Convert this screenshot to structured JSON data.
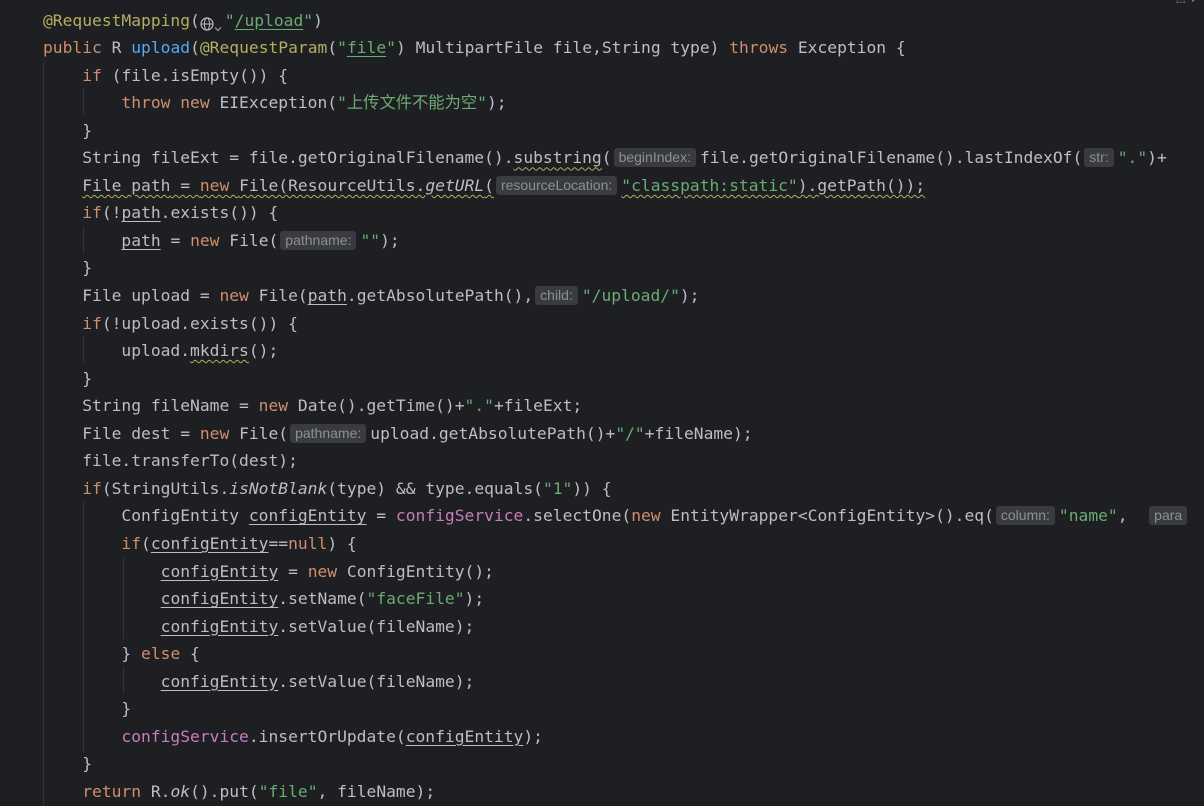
{
  "editor": {
    "lines": [
      {
        "tokens": [
          {
            "t": "@RequestMapping",
            "c": "ann"
          },
          {
            "t": "(",
            "c": "p"
          },
          {
            "icon": "globe-icon"
          },
          {
            "icon": "chevron-down-icon"
          },
          {
            "t": "\"",
            "c": "str"
          },
          {
            "t": "/upload",
            "c": "str ul"
          },
          {
            "t": "\"",
            "c": "str"
          },
          {
            "t": ")",
            "c": "p"
          }
        ]
      },
      {
        "tokens": [
          {
            "t": "public ",
            "c": "kw"
          },
          {
            "t": "R ",
            "c": "p"
          },
          {
            "t": "upload",
            "c": "fn"
          },
          {
            "t": "(",
            "c": "p"
          },
          {
            "t": "@RequestParam",
            "c": "ann"
          },
          {
            "t": "(",
            "c": "p"
          },
          {
            "t": "\"",
            "c": "str"
          },
          {
            "t": "file",
            "c": "str ul"
          },
          {
            "t": "\"",
            "c": "str"
          },
          {
            "t": ") MultipartFile file,String type) ",
            "c": "p"
          },
          {
            "t": "throws ",
            "c": "kw"
          },
          {
            "t": "Exception {",
            "c": "p"
          }
        ]
      },
      {
        "tokens": [
          {
            "t": "    "
          },
          {
            "t": "if ",
            "c": "kw"
          },
          {
            "t": "(file.isEmpty()) {",
            "c": "p"
          }
        ]
      },
      {
        "tokens": [
          {
            "t": "        "
          },
          {
            "t": "throw new ",
            "c": "kw"
          },
          {
            "t": "EIException(",
            "c": "p"
          },
          {
            "t": "\"上传文件不能为空\"",
            "c": "str"
          },
          {
            "t": ");",
            "c": "p"
          }
        ]
      },
      {
        "tokens": [
          {
            "t": "    "
          },
          {
            "t": "}",
            "c": "p"
          }
        ]
      },
      {
        "tokens": [
          {
            "t": "    "
          },
          {
            "t": "String fileExt = file.getOriginalFilename().",
            "c": "p"
          },
          {
            "t": "substring",
            "c": "p wavy"
          },
          {
            "t": "(",
            "c": "p"
          },
          {
            "hint": "beginIndex:"
          },
          {
            "t": "file.getOriginalFilename().lastIndexOf(",
            "c": "p"
          },
          {
            "hint": "str:"
          },
          {
            "t": "\".\"",
            "c": "str"
          },
          {
            "t": ")+",
            "c": "p"
          }
        ]
      },
      {
        "tokens": [
          {
            "t": "    "
          },
          {
            "t": "File ",
            "c": "p wavy"
          },
          {
            "t": "path",
            "c": "p wavy ul"
          },
          {
            "t": " = ",
            "c": "p wavy"
          },
          {
            "t": "new ",
            "c": "kw wavy"
          },
          {
            "t": "File(ResourceUtils.",
            "c": "p wavy"
          },
          {
            "t": "getURL",
            "c": "p ital wavy"
          },
          {
            "t": "(",
            "c": "p wavy"
          },
          {
            "hint": "resourceLocation:"
          },
          {
            "t": "\"classpath:static\"",
            "c": "str wavy"
          },
          {
            "t": ").getPath());",
            "c": "p wavy"
          }
        ]
      },
      {
        "tokens": [
          {
            "t": "    "
          },
          {
            "t": "if",
            "c": "kw"
          },
          {
            "t": "(!",
            "c": "p"
          },
          {
            "t": "path",
            "c": "p ul"
          },
          {
            "t": ".exists()) {",
            "c": "p"
          }
        ]
      },
      {
        "tokens": [
          {
            "t": "        "
          },
          {
            "t": "path",
            "c": "p ul"
          },
          {
            "t": " = ",
            "c": "p"
          },
          {
            "t": "new ",
            "c": "kw"
          },
          {
            "t": "File(",
            "c": "p"
          },
          {
            "hint": "pathname:"
          },
          {
            "t": "\"\"",
            "c": "str"
          },
          {
            "t": ");",
            "c": "p"
          }
        ]
      },
      {
        "tokens": [
          {
            "t": "    "
          },
          {
            "t": "}",
            "c": "p"
          }
        ]
      },
      {
        "tokens": [
          {
            "t": "    "
          },
          {
            "t": "File upload = ",
            "c": "p"
          },
          {
            "t": "new ",
            "c": "kw"
          },
          {
            "t": "File(",
            "c": "p"
          },
          {
            "t": "path",
            "c": "p ul"
          },
          {
            "t": ".getAbsolutePath(),",
            "c": "p"
          },
          {
            "hint": "child:"
          },
          {
            "t": "\"/upload/\"",
            "c": "str"
          },
          {
            "t": ");",
            "c": "p"
          }
        ]
      },
      {
        "tokens": [
          {
            "t": "    "
          },
          {
            "t": "if",
            "c": "kw"
          },
          {
            "t": "(!upload.exists()) {",
            "c": "p"
          }
        ]
      },
      {
        "tokens": [
          {
            "t": "        "
          },
          {
            "t": "upload.",
            "c": "p"
          },
          {
            "t": "mkdirs",
            "c": "p wavy"
          },
          {
            "t": "();",
            "c": "p"
          }
        ]
      },
      {
        "tokens": [
          {
            "t": "    "
          },
          {
            "t": "}",
            "c": "p"
          }
        ]
      },
      {
        "tokens": [
          {
            "t": "    "
          },
          {
            "t": "String fileName = ",
            "c": "p"
          },
          {
            "t": "new ",
            "c": "kw"
          },
          {
            "t": "Date().getTime()+",
            "c": "p"
          },
          {
            "t": "\".\"",
            "c": "str"
          },
          {
            "t": "+fileExt;",
            "c": "p"
          }
        ]
      },
      {
        "tokens": [
          {
            "t": "    "
          },
          {
            "t": "File dest = ",
            "c": "p"
          },
          {
            "t": "new ",
            "c": "kw"
          },
          {
            "t": "File(",
            "c": "p"
          },
          {
            "hint": "pathname:"
          },
          {
            "t": "upload.getAbsolutePath()+",
            "c": "p"
          },
          {
            "t": "\"/\"",
            "c": "str"
          },
          {
            "t": "+fileName);",
            "c": "p"
          }
        ]
      },
      {
        "tokens": [
          {
            "t": "    "
          },
          {
            "t": "file.transferTo(dest);",
            "c": "p"
          }
        ]
      },
      {
        "tokens": [
          {
            "t": "    "
          },
          {
            "t": "if",
            "c": "kw"
          },
          {
            "t": "(StringUtils.",
            "c": "p"
          },
          {
            "t": "isNotBlank",
            "c": "p ital"
          },
          {
            "t": "(type) && type.equals(",
            "c": "p"
          },
          {
            "t": "\"1\"",
            "c": "str"
          },
          {
            "t": ")) {",
            "c": "p"
          }
        ]
      },
      {
        "tokens": [
          {
            "t": "        "
          },
          {
            "t": "ConfigEntity ",
            "c": "p"
          },
          {
            "t": "configEntity",
            "c": "p ul"
          },
          {
            "t": " = ",
            "c": "p"
          },
          {
            "t": "configService",
            "c": "field"
          },
          {
            "t": ".selectOne(",
            "c": "p"
          },
          {
            "t": "new ",
            "c": "kw"
          },
          {
            "t": "EntityWrapper<ConfigEntity>().eq(",
            "c": "p"
          },
          {
            "hint": "column:"
          },
          {
            "t": "\"name\"",
            "c": "str"
          },
          {
            "t": ",  ",
            "c": "p"
          },
          {
            "hint": "para"
          }
        ]
      },
      {
        "tokens": [
          {
            "t": "        "
          },
          {
            "t": "if",
            "c": "kw"
          },
          {
            "t": "(",
            "c": "p"
          },
          {
            "t": "configEntity",
            "c": "p ul"
          },
          {
            "t": "==",
            "c": "p"
          },
          {
            "t": "null",
            "c": "kw"
          },
          {
            "t": ") {",
            "c": "p"
          }
        ]
      },
      {
        "tokens": [
          {
            "t": "            "
          },
          {
            "t": "configEntity",
            "c": "p ul"
          },
          {
            "t": " = ",
            "c": "p"
          },
          {
            "t": "new ",
            "c": "kw"
          },
          {
            "t": "ConfigEntity();",
            "c": "p"
          }
        ]
      },
      {
        "tokens": [
          {
            "t": "            "
          },
          {
            "t": "configEntity",
            "c": "p ul"
          },
          {
            "t": ".setName(",
            "c": "p"
          },
          {
            "t": "\"faceFile\"",
            "c": "str"
          },
          {
            "t": ");",
            "c": "p"
          }
        ]
      },
      {
        "tokens": [
          {
            "t": "            "
          },
          {
            "t": "configEntity",
            "c": "p ul"
          },
          {
            "t": ".setValue(fileName);",
            "c": "p"
          }
        ]
      },
      {
        "tokens": [
          {
            "t": "        "
          },
          {
            "t": "} ",
            "c": "p"
          },
          {
            "t": "else ",
            "c": "kw"
          },
          {
            "t": "{",
            "c": "p"
          }
        ]
      },
      {
        "tokens": [
          {
            "t": "            "
          },
          {
            "t": "configEntity",
            "c": "p ul"
          },
          {
            "t": ".setValue(fileName);",
            "c": "p"
          }
        ]
      },
      {
        "tokens": [
          {
            "t": "        "
          },
          {
            "t": "}",
            "c": "p"
          }
        ]
      },
      {
        "tokens": [
          {
            "t": "        "
          },
          {
            "t": "configService",
            "c": "field"
          },
          {
            "t": ".insertOrUpdate(",
            "c": "p"
          },
          {
            "t": "configEntity",
            "c": "p ul"
          },
          {
            "t": ");",
            "c": "p"
          }
        ]
      },
      {
        "tokens": [
          {
            "t": "    "
          },
          {
            "t": "}",
            "c": "p"
          }
        ]
      },
      {
        "tokens": [
          {
            "t": "    "
          },
          {
            "t": "return ",
            "c": "kw"
          },
          {
            "t": "R.",
            "c": "p"
          },
          {
            "t": "ok",
            "c": "p ital"
          },
          {
            "t": "().put(",
            "c": "p"
          },
          {
            "t": "\"file\"",
            "c": "str"
          },
          {
            "t": ", fileName);",
            "c": "p"
          }
        ]
      }
    ]
  },
  "colors": {
    "background": "#1e1f22",
    "text": "#bcbec4",
    "keyword": "#cf8e6d",
    "string": "#6aab73",
    "annotation": "#b3ae60",
    "method": "#56a8f5",
    "field": "#c77dbb",
    "hint_bg": "#393b40",
    "hint_text": "#8c8f94"
  }
}
